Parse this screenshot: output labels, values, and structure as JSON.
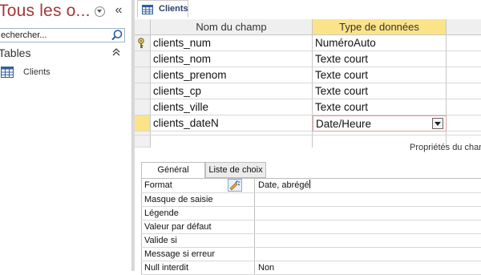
{
  "nav": {
    "title": "Tous les o...",
    "search_placeholder": "echercher...",
    "group_label": "Tables",
    "items": [
      {
        "label": "Clients",
        "icon": "table-icon"
      }
    ]
  },
  "document": {
    "tab_label": "Clients",
    "columns": {
      "field_name": "Nom du champ",
      "data_type": "Type de données"
    },
    "rows": [
      {
        "name": "clients_num",
        "type": "NuméroAuto",
        "primary_key": true
      },
      {
        "name": "clients_nom",
        "type": "Texte court"
      },
      {
        "name": "clients_prenom",
        "type": "Texte court"
      },
      {
        "name": "clients_cp",
        "type": "Texte court"
      },
      {
        "name": "clients_ville",
        "type": "Texte court"
      },
      {
        "name": "clients_dateN",
        "type": "Date/Heure",
        "active": true
      }
    ],
    "properties_caption": "Propriétés du champ"
  },
  "properties": {
    "tabs": [
      "Général",
      "Liste de choix"
    ],
    "active_tab": "Général",
    "rows": [
      {
        "label": "Format",
        "value": "Date, abrégé"
      },
      {
        "label": "Masque de saisie",
        "value": ""
      },
      {
        "label": "Légende",
        "value": ""
      },
      {
        "label": "Valeur par défaut",
        "value": ""
      },
      {
        "label": "Valide si",
        "value": ""
      },
      {
        "label": "Message si erreur",
        "value": ""
      },
      {
        "label": "Null interdit",
        "value": "Non"
      }
    ]
  },
  "colors": {
    "title_red": "#a4373a",
    "header_highlight": "#fbe38a",
    "tab_text": "#2b3f6b"
  }
}
